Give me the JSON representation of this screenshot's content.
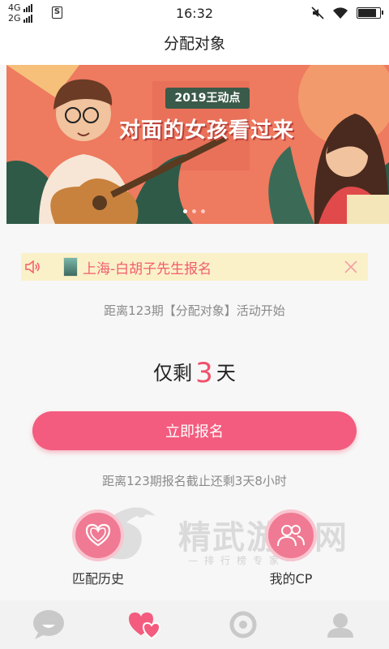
{
  "status_bar": {
    "network_1": "4G",
    "network_2": "2G",
    "sim_label": "S",
    "time": "16:32",
    "icons": [
      "mute-icon",
      "wifi-icon",
      "battery-icon"
    ]
  },
  "header": {
    "title": "分配对象"
  },
  "banner": {
    "badge": "2019王动点",
    "headline": "对面的女孩看过来",
    "slide_count": 3,
    "active_slide": 1
  },
  "notice": {
    "icon": "speaker-icon",
    "text": "上海-白胡子先生报名",
    "close_icon": "close-icon"
  },
  "countdown": {
    "info": "距离123期【分配对象】活动开始",
    "prefix": "仅剩",
    "days": "3",
    "suffix": "天"
  },
  "signup_button": {
    "label": "立即报名"
  },
  "deadline": {
    "text": "距离123期报名截止还剩3天8小时"
  },
  "watermark": {
    "text": "精武游戏网",
    "sub": "—排行榜专家—"
  },
  "actions": [
    {
      "label": "匹配历史",
      "icon": "heart-icon"
    },
    {
      "label": "我的CP",
      "icon": "couple-icon"
    }
  ],
  "tabbar": {
    "items": [
      "chat-icon",
      "hearts-icon",
      "circle-icon",
      "profile-icon"
    ],
    "active_index": 1
  },
  "colors": {
    "accent": "#f35c7e",
    "countdown_number": "#f04f6c",
    "notice_text": "#f25c6e",
    "notice_bg": "#fbf1c8"
  }
}
